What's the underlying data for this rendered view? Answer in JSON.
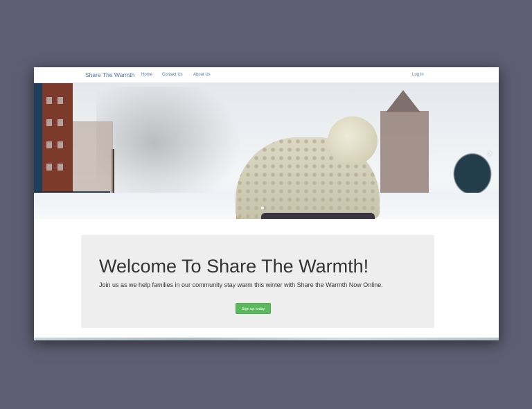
{
  "navbar": {
    "brand": "Share The Warmth",
    "links": [
      "Home",
      "Contact Us",
      "About Us"
    ],
    "login": "Log In"
  },
  "carousel": {
    "next_icon": "chevron-right-icon",
    "next_glyph": "›"
  },
  "jumbotron": {
    "title": "Welcome To Share The Warmth!",
    "subtitle": "Join us as we help families in our community stay warm this winter with Share the Warmth Now Online.",
    "button": "Sign up today"
  },
  "colors": {
    "backdrop": "#5d5d73",
    "link": "#4a76a8",
    "jumbotron_bg": "#eeeeee",
    "button_green": "#5cb85c"
  }
}
